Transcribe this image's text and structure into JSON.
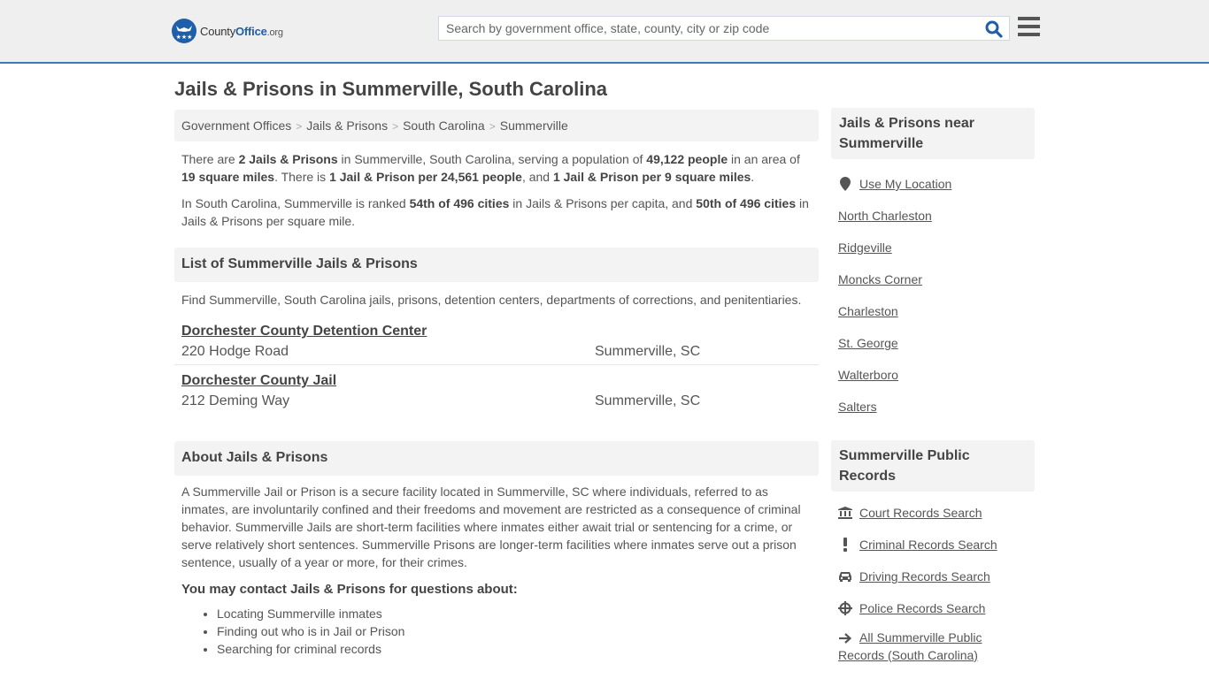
{
  "header": {
    "logo": {
      "county": "County",
      "office": "Office",
      "org": ".org"
    },
    "search_placeholder": "Search by government office, state, county, city or zip code",
    "search_icon": "search-icon",
    "menu_icon": "hamburger-menu-icon"
  },
  "page_title": "Jails & Prisons in Summerville, South Carolina",
  "breadcrumb": [
    "Government Offices",
    "Jails & Prisons",
    "South Carolina",
    "Summerville"
  ],
  "summary": {
    "p1": {
      "t1": "There are ",
      "b1": "2 Jails & Prisons",
      "t2": " in Summerville, South Carolina, serving a population of ",
      "b2": "49,122 people",
      "t3": " in an area of ",
      "b3": "19 square miles",
      "t4": ". There is ",
      "b4": "1 Jail & Prison per 24,561 people",
      "t5": ", and ",
      "b5": "1 Jail & Prison per 9 square miles",
      "t6": "."
    },
    "p2": {
      "t1": "In South Carolina, Summerville is ranked ",
      "b1": "54th of 496 cities",
      "t2": " in Jails & Prisons per capita, and ",
      "b2": "50th of 496 cities",
      "t3": " in Jails & Prisons per square mile."
    }
  },
  "list": {
    "heading": "List of Summerville Jails & Prisons",
    "intro": "Find Summerville, South Carolina jails, prisons, detention centers, departments of corrections, and penitentiaries.",
    "items": [
      {
        "name": "Dorchester County Detention Center",
        "address": "220 Hodge Road",
        "city": "Summerville, SC"
      },
      {
        "name": "Dorchester County Jail",
        "address": "212 Deming Way",
        "city": "Summerville, SC"
      }
    ]
  },
  "about": {
    "heading": "About Jails & Prisons",
    "text": "A Summerville Jail or Prison is a secure facility located in Summerville, SC where individuals, referred to as inmates, are involuntarily confined and their freedoms and movement are restricted as a consequence of criminal behavior. Summerville Jails are short-term facilities where inmates either await trial or sentencing for a crime, or serve relatively short sentences. Summerville Prisons are longer-term facilities where inmates serve out a prison sentence, usually of a year or more, for their crimes.",
    "contact_heading": "You may contact Jails & Prisons for questions about:",
    "contact_items": [
      "Locating Summerville inmates",
      "Finding out who is in Jail or Prison",
      "Searching for criminal records"
    ]
  },
  "sidebar": {
    "near": {
      "heading": "Jails & Prisons near Summerville",
      "use_location": "Use My Location",
      "cities": [
        "North Charleston",
        "Ridgeville",
        "Moncks Corner",
        "Charleston",
        "St. George",
        "Walterboro",
        "Salters"
      ]
    },
    "records": {
      "heading": "Summerville Public Records",
      "links": [
        {
          "label": "Court Records Search",
          "icon": "courthouse-icon"
        },
        {
          "label": "Criminal Records Search",
          "icon": "exclamation-icon"
        },
        {
          "label": "Driving Records Search",
          "icon": "car-icon"
        },
        {
          "label": "Police Records Search",
          "icon": "crosshair-icon"
        },
        {
          "label": "All Summerville Public Records (South Carolina)",
          "icon": "arrow-right-icon"
        }
      ]
    }
  }
}
